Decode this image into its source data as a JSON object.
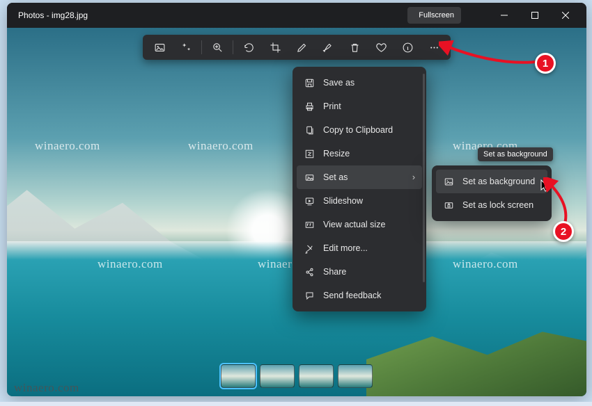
{
  "titlebar": {
    "app": "Photos",
    "file": "img28.jpg",
    "title": "Photos - img28.jpg",
    "fullscreen": "Fullscreen"
  },
  "toolbar": {
    "icons": [
      "image",
      "sparkles",
      "zoom",
      "rotate",
      "crop",
      "edit",
      "markup",
      "delete",
      "favorite",
      "info",
      "more"
    ]
  },
  "menu": {
    "items": [
      {
        "icon": "save",
        "label": "Save as"
      },
      {
        "icon": "print",
        "label": "Print"
      },
      {
        "icon": "copy",
        "label": "Copy to Clipboard"
      },
      {
        "icon": "resize",
        "label": "Resize"
      },
      {
        "icon": "setas",
        "label": "Set as",
        "submenu": true
      },
      {
        "icon": "slideshow",
        "label": "Slideshow"
      },
      {
        "icon": "actual",
        "label": "View actual size"
      },
      {
        "icon": "editmore",
        "label": "Edit more..."
      },
      {
        "icon": "share",
        "label": "Share"
      },
      {
        "icon": "feedback",
        "label": "Send feedback"
      }
    ],
    "selected_index": 4
  },
  "submenu": {
    "tooltip": "Set as background",
    "items": [
      {
        "icon": "bg",
        "label": "Set as background",
        "selected": true
      },
      {
        "icon": "lock",
        "label": "Set as lock screen"
      }
    ]
  },
  "callouts": {
    "one": "1",
    "two": "2"
  },
  "filmstrip": {
    "count": 4,
    "selected": 0
  },
  "watermark": "winaero.com"
}
